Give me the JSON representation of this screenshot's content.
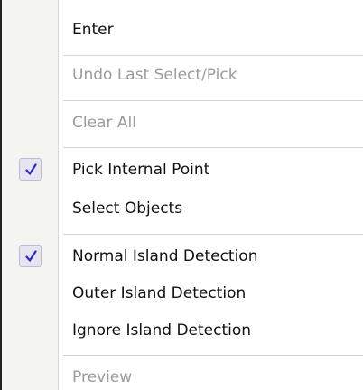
{
  "menu": {
    "items": [
      {
        "label": "Enter",
        "enabled": true,
        "checked": false
      },
      {
        "label": "Undo Last Select/Pick",
        "enabled": false,
        "checked": false
      },
      {
        "label": "Clear All",
        "enabled": false,
        "checked": false
      },
      {
        "label": "Pick Internal Point",
        "enabled": true,
        "checked": true
      },
      {
        "label": "Select Objects",
        "enabled": true,
        "checked": false
      },
      {
        "label": "Normal Island Detection",
        "enabled": true,
        "checked": true
      },
      {
        "label": "Outer Island Detection",
        "enabled": true,
        "checked": false
      },
      {
        "label": "Ignore Island Detection",
        "enabled": true,
        "checked": false
      },
      {
        "label": "Preview",
        "enabled": false,
        "checked": false
      }
    ],
    "check_icon": "check-icon",
    "colors": {
      "text": "#111111",
      "disabled_text": "#9b9b9b",
      "gutter": "#f4f4f0",
      "check_bg": "#e7e4f2",
      "check_mark": "#2b2bc8"
    }
  }
}
